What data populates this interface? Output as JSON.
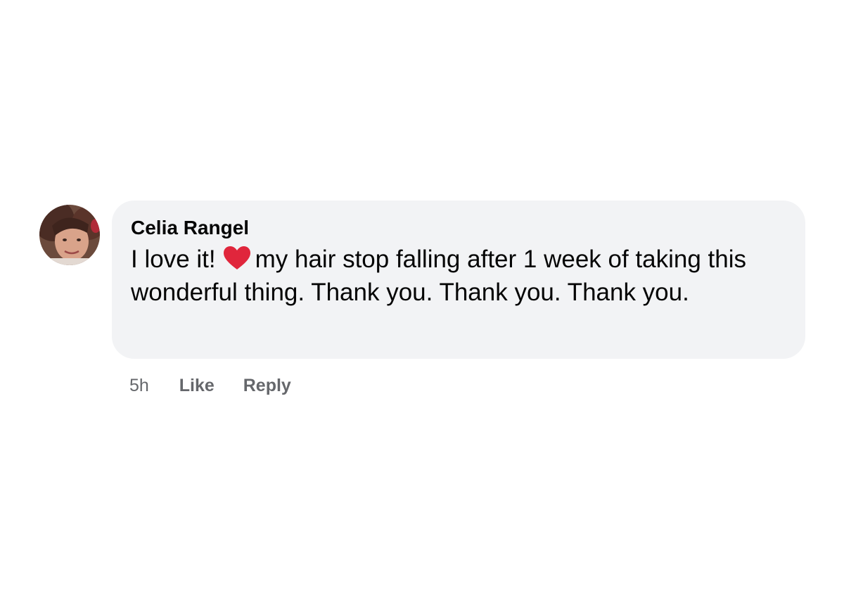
{
  "comment": {
    "author": "Celia Rangel",
    "text_before_emoji": "I love it!",
    "emoji_icon": "red-heart-icon",
    "text_after_emoji": "my hair stop falling after 1 week of taking this wonderful thing. Thank you. Thank you. Thank you.",
    "timestamp": "5h",
    "like_label": "Like",
    "reply_label": "Reply"
  },
  "colors": {
    "bubble_background": "#f2f3f5",
    "secondary_text": "#65676b",
    "heart": "#e0263c"
  }
}
